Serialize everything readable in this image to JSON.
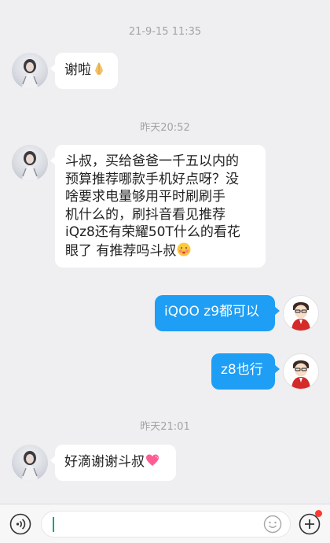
{
  "messages": {
    "ts1": "21-9-15 11:35",
    "m1_text": "谢啦",
    "ts2": "昨天20:52",
    "m2_line1": "斗叔，买给爸爸一千五以内的",
    "m2_line2": "预算推荐哪款手机好点呀？没",
    "m2_line3": "啥要求电量够用平时刷刷手",
    "m2_line4": "机什么的，刷抖音看见推荐",
    "m2_line5": "iQz8还有荣耀50T什么的看花",
    "m2_line6": "眼了 有推荐吗斗叔",
    "m3_text": "iQOO z9都可以",
    "m4_text": "z8也行",
    "ts3": "昨天21:01",
    "m5_text": "好滴谢谢斗叔"
  },
  "icons": {
    "voice": "voice-icon",
    "emoji": "smiley-icon",
    "plus": "plus-icon",
    "clap": "folded-hands-emoji",
    "shy": "blushing-face-emoji",
    "heart": "heart-emoji"
  },
  "colors": {
    "outgoing_bubble": "#1e9ef5",
    "incoming_bubble": "#ffffff",
    "background": "#efeff1",
    "notification_dot": "#ff3b30"
  }
}
